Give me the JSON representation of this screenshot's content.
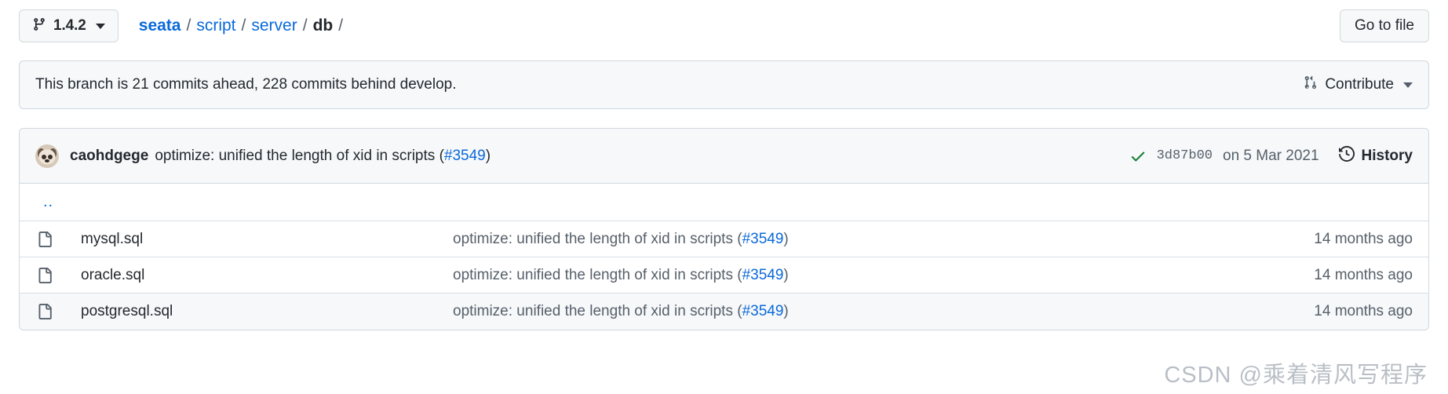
{
  "topbar": {
    "branch": {
      "name": "1.4.2",
      "icon": "git-branch-icon",
      "caret_icon": "chevron-down-icon"
    },
    "breadcrumb": {
      "segments": [
        {
          "label": "seata",
          "type": "link-bold"
        },
        {
          "label": "script",
          "type": "link"
        },
        {
          "label": "server",
          "type": "link"
        },
        {
          "label": "db",
          "type": "current"
        }
      ],
      "separator": "/",
      "trailing_separator": "/"
    },
    "go_to_file_label": "Go to file"
  },
  "banner": {
    "message": "This branch is 21 commits ahead, 228 commits behind develop.",
    "contribute_label": "Contribute",
    "contribute_icon": "git-pull-request-icon",
    "contribute_caret_icon": "chevron-down-icon"
  },
  "commit_header": {
    "avatar_name": "caohdgege-avatar",
    "author": "caohdgege",
    "message": "optimize: unified the length of xid in scripts ",
    "issue_open_paren": "(",
    "issue_link": "#3549",
    "issue_close_paren": ")",
    "status_icon": "check-icon",
    "sha": "3d87b00",
    "date": "on 5 Mar 2021",
    "history_label": "History",
    "history_icon": "history-clock-icon"
  },
  "files": {
    "parent_dir_label": "..",
    "rows": [
      {
        "icon": "file-icon",
        "name": "mysql.sql",
        "message": "optimize: unified the length of xid in scripts ",
        "issue_open_paren": "(",
        "issue_link": "#3549",
        "issue_close_paren": ")",
        "time": "14 months ago",
        "shaded": false
      },
      {
        "icon": "file-icon",
        "name": "oracle.sql",
        "message": "optimize: unified the length of xid in scripts ",
        "issue_open_paren": "(",
        "issue_link": "#3549",
        "issue_close_paren": ")",
        "time": "14 months ago",
        "shaded": false
      },
      {
        "icon": "file-icon",
        "name": "postgresql.sql",
        "message": "optimize: unified the length of xid in scripts ",
        "issue_open_paren": "(",
        "issue_link": "#3549",
        "issue_close_paren": ")",
        "time": "14 months ago",
        "shaded": true
      }
    ]
  },
  "watermark": "CSDN @乘着清风写程序",
  "colors": {
    "link": "#0969da",
    "text": "#24292f",
    "muted": "#57606a",
    "border": "#d0d7de",
    "surface": "#f6f8fa",
    "success": "#1a7f37"
  }
}
